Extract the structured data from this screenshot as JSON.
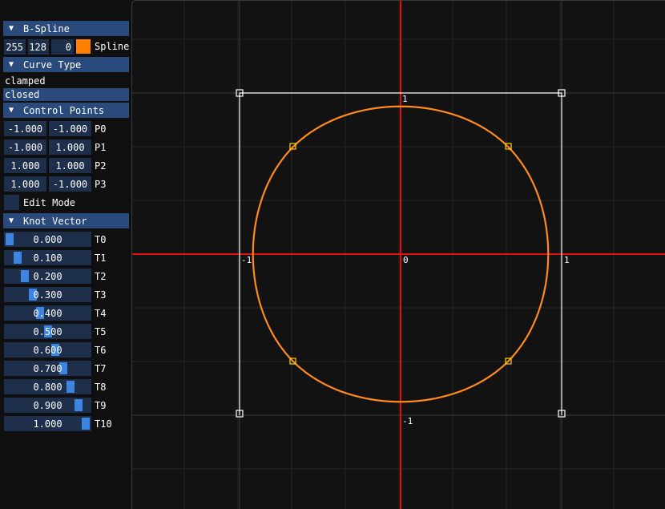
{
  "bspline": {
    "header": "B-Spline",
    "color": {
      "r": "255",
      "g": "128",
      "b": "0",
      "swatch_hex": "#ff8000",
      "label": "Spline"
    }
  },
  "curve_type": {
    "header": "Curve Type",
    "options": [
      "clamped",
      "closed"
    ],
    "selected": "closed"
  },
  "control_points": {
    "header": "Control Points",
    "points": [
      {
        "x": "-1.000",
        "y": "-1.000",
        "label": "P0"
      },
      {
        "x": "-1.000",
        "y": "1.000",
        "label": "P1"
      },
      {
        "x": "1.000",
        "y": "1.000",
        "label": "P2"
      },
      {
        "x": "1.000",
        "y": "-1.000",
        "label": "P3"
      }
    ],
    "edit_mode_label": "Edit Mode"
  },
  "knot_vector": {
    "header": "Knot Vector",
    "knots": [
      {
        "value": "0.000",
        "fraction": 0.0,
        "label": "T0"
      },
      {
        "value": "0.100",
        "fraction": 0.1,
        "label": "T1"
      },
      {
        "value": "0.200",
        "fraction": 0.2,
        "label": "T2"
      },
      {
        "value": "0.300",
        "fraction": 0.3,
        "label": "T3"
      },
      {
        "value": "0.400",
        "fraction": 0.4,
        "label": "T4"
      },
      {
        "value": "0.500",
        "fraction": 0.5,
        "label": "T5"
      },
      {
        "value": "0.600",
        "fraction": 0.6,
        "label": "T6"
      },
      {
        "value": "0.700",
        "fraction": 0.7,
        "label": "T7"
      },
      {
        "value": "0.800",
        "fraction": 0.8,
        "label": "T8"
      },
      {
        "value": "0.900",
        "fraction": 0.9,
        "label": "T9"
      },
      {
        "value": "1.000",
        "fraction": 1.0,
        "label": "T10"
      }
    ]
  },
  "plot": {
    "axis_labels": {
      "x_neg": "-1",
      "x_pos": "1",
      "y_pos": "1",
      "y_neg": "-1",
      "origin": "0"
    },
    "colors": {
      "axis": "#e01010",
      "grid": "#2a2a2a",
      "curve": "#ff8a1e",
      "polygon": "#ffffff",
      "curve_point": "#ffd000"
    }
  }
}
